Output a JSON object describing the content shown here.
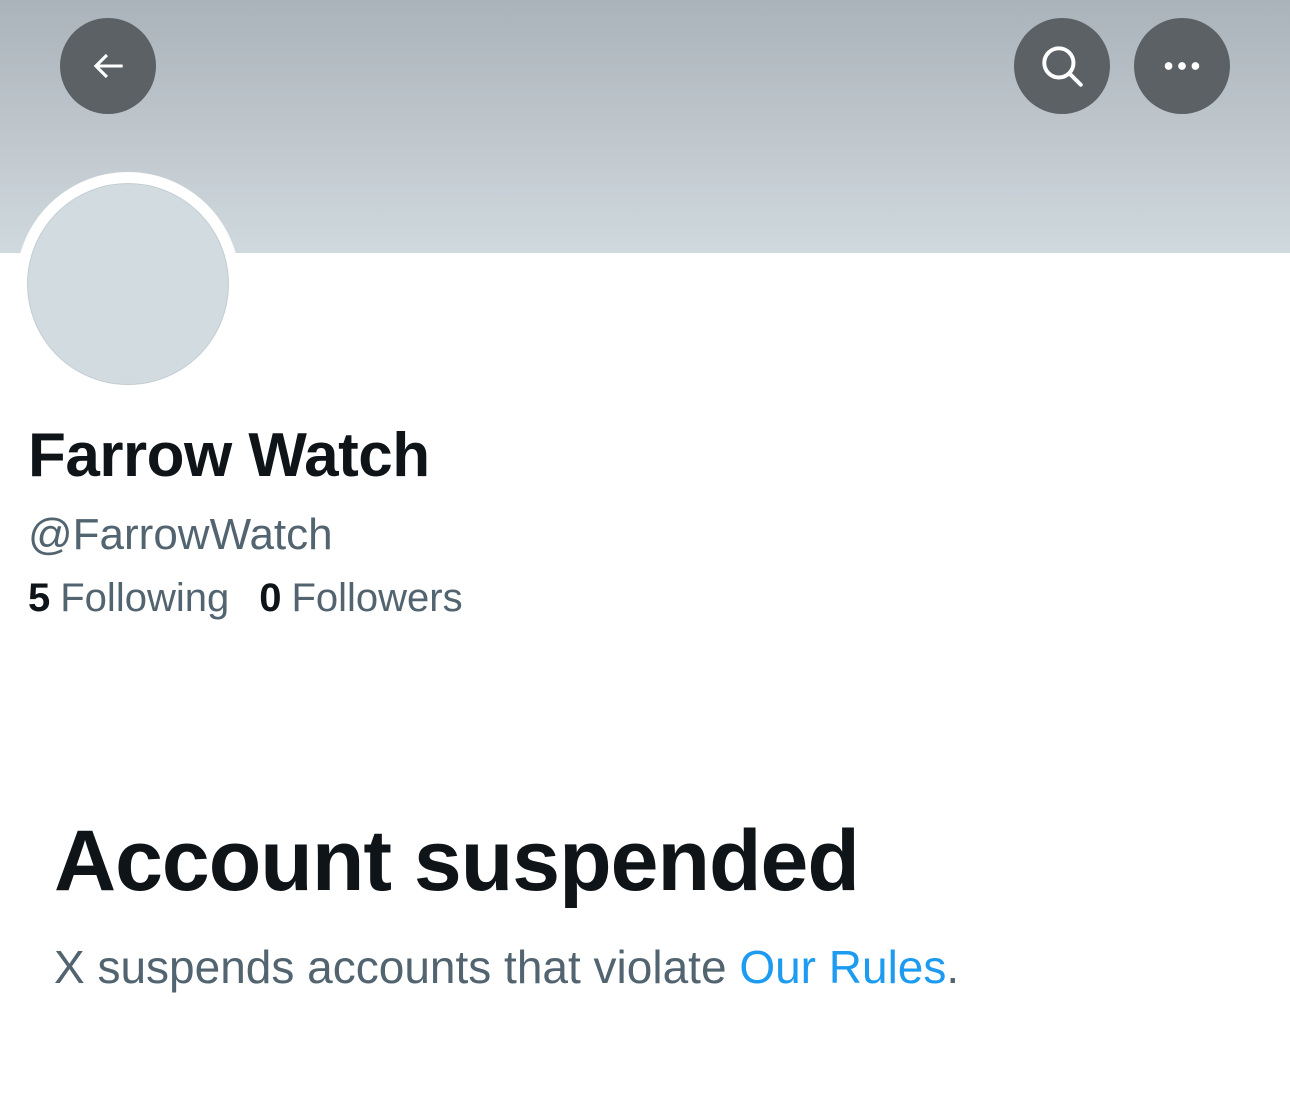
{
  "header": {
    "back_icon": "arrow-left-icon",
    "search_icon": "search-icon",
    "more_icon": "more-horizontal-icon",
    "button_color": "#5b6164",
    "banner_color": "#cfd9de"
  },
  "profile": {
    "display_name": "Farrow Watch",
    "handle": "@FarrowWatch",
    "following_count": "5",
    "following_label": "Following",
    "followers_count": "0",
    "followers_label": "Followers",
    "avatar_color": "#d2dbe0"
  },
  "notice": {
    "title": "Account suspended",
    "description": "X suspends accounts that violate ",
    "link_text": "Our Rules",
    "trailing": ".",
    "link_color": "#1d9bf0"
  }
}
